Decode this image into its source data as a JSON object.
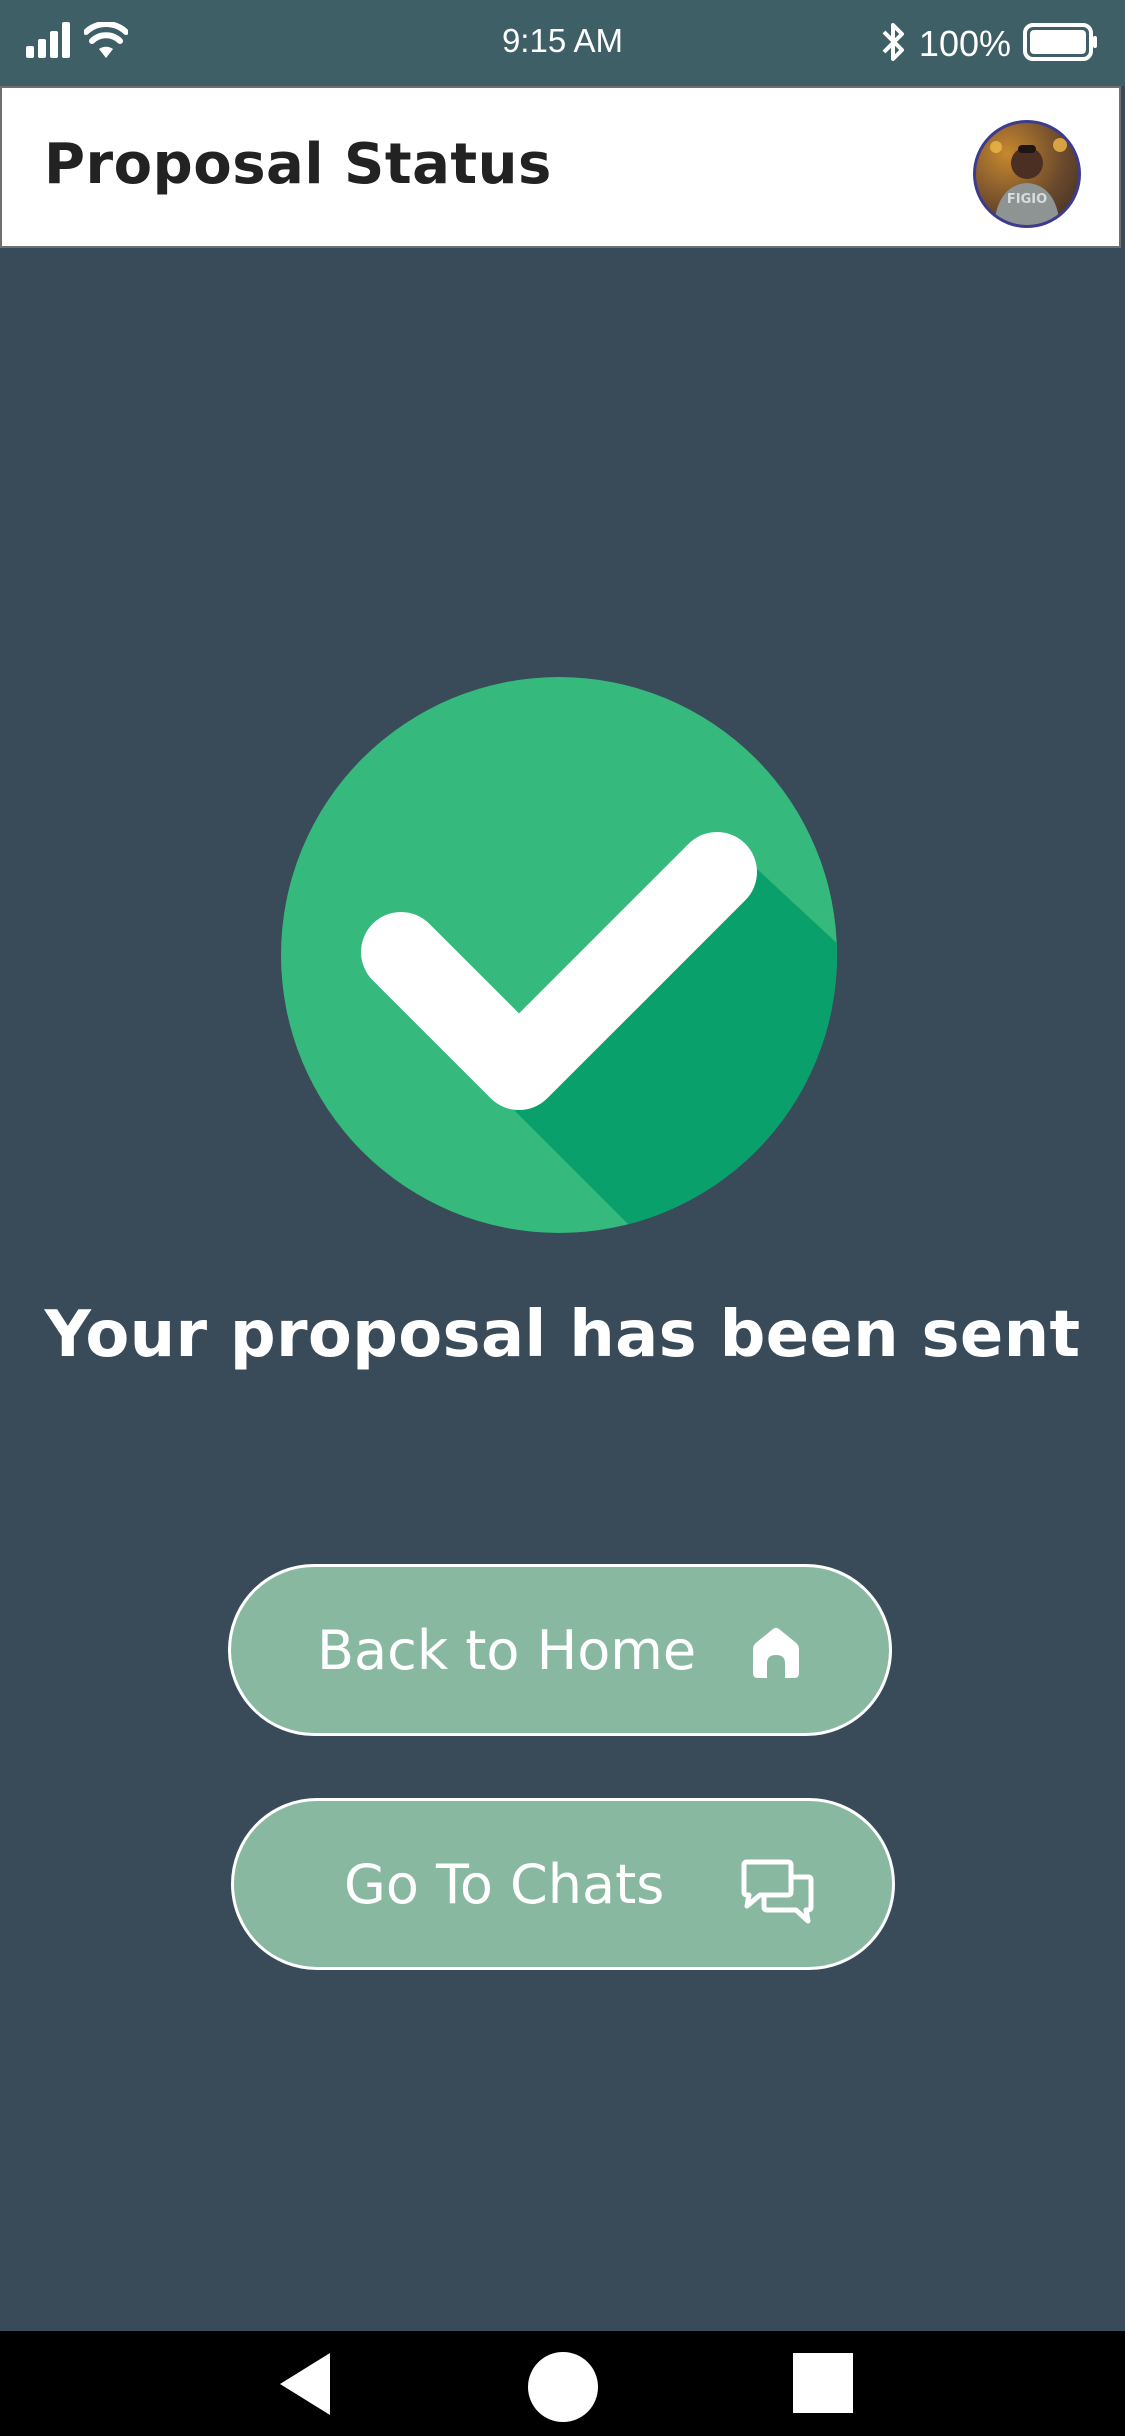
{
  "status_bar": {
    "time": "9:15 AM",
    "battery": "100%",
    "icons": [
      "signal-icon",
      "wifi-icon",
      "bluetooth-icon",
      "battery-icon"
    ]
  },
  "header": {
    "title": "Proposal Status",
    "avatar_text": "FIGIO"
  },
  "main": {
    "icon": "check-circle-icon",
    "message": "Your proposal has been sent"
  },
  "buttons": {
    "home": {
      "label": "Back to Home",
      "icon": "home-icon"
    },
    "chats": {
      "label": "Go To Chats",
      "icon": "chat-bubbles-icon"
    }
  },
  "nav": {
    "icons": [
      "back-triangle-icon",
      "home-circle-icon",
      "recent-square-icon"
    ]
  },
  "colors": {
    "background": "#394a59",
    "status_bar": "#3e5f66",
    "header": "#ffffff",
    "button": "#88b9a0",
    "check_light": "#35b97d",
    "check_dark": "#0aa06b"
  }
}
